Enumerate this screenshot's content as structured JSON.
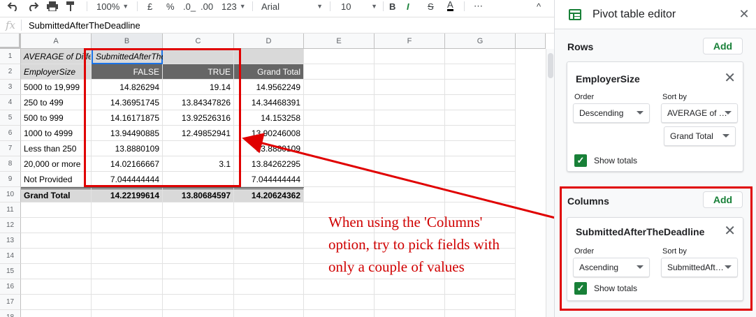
{
  "toolbar": {
    "zoom": "100%",
    "currency": "£",
    "percent": "%",
    "dec_decrease": ".0_",
    "dec_increase": ".00",
    "more_formats": "123",
    "font": "Arial",
    "font_size": "10",
    "bold": "B",
    "italic": "I",
    "strike": "S",
    "text_color": "A",
    "more": "⋯",
    "collapse": "^"
  },
  "formula_bar": {
    "fx": "fx",
    "value": "SubmittedAfterTheDeadline"
  },
  "columns": [
    "A",
    "B",
    "C",
    "D",
    "E",
    "F",
    "G"
  ],
  "rows": [
    "1",
    "2",
    "3",
    "4",
    "5",
    "6",
    "7",
    "8",
    "9",
    "10",
    "11",
    "12",
    "13",
    "14",
    "15",
    "16",
    "17",
    "18"
  ],
  "pivot": {
    "a1": "AVERAGE of Difference",
    "b1": "SubmittedAfterTheDeadline",
    "header": [
      "EmployerSize",
      "FALSE",
      "TRUE",
      "Grand Total"
    ],
    "body": [
      [
        "5000 to 19,999",
        "14.826294",
        "19.14",
        "14.9562249"
      ],
      [
        "250 to 499",
        "14.36951745",
        "13.84347826",
        "14.34468391"
      ],
      [
        "500 to 999",
        "14.16171875",
        "13.92526316",
        "14.153258"
      ],
      [
        "1000 to 4999",
        "13.94490885",
        "12.49852941",
        "13.90246008"
      ],
      [
        "Less than 250",
        "13.8880109",
        "",
        "13.8880109"
      ],
      [
        "20,000 or more",
        "14.02166667",
        "3.1",
        "13.84262295"
      ],
      [
        "Not Provided",
        "7.044444444",
        "",
        "7.044444444"
      ]
    ],
    "grand_total": [
      "Grand Total",
      "14.22199614",
      "13.80684597",
      "14.20624362"
    ]
  },
  "annotation": {
    "lines": [
      "When using the 'Columns'",
      "option, try to pick fields with",
      "only a couple of values"
    ],
    "color": "#d00000"
  },
  "panel": {
    "title": "Pivot table editor",
    "rows_label": "Rows",
    "add_label": "Add",
    "rows_card": {
      "field": "EmployerSize",
      "order_label": "Order",
      "sort_label": "Sort by",
      "order_value": "Descending",
      "sort_value": "AVERAGE of …",
      "sort_sub_value": "Grand Total",
      "show_totals": "Show totals"
    },
    "columns_label": "Columns",
    "columns_card": {
      "field": "SubmittedAfterTheDeadline",
      "order_label": "Order",
      "sort_label": "Sort by",
      "order_value": "Ascending",
      "sort_value": "SubmittedAft…",
      "show_totals": "Show totals"
    },
    "accent_color": "#188038"
  }
}
